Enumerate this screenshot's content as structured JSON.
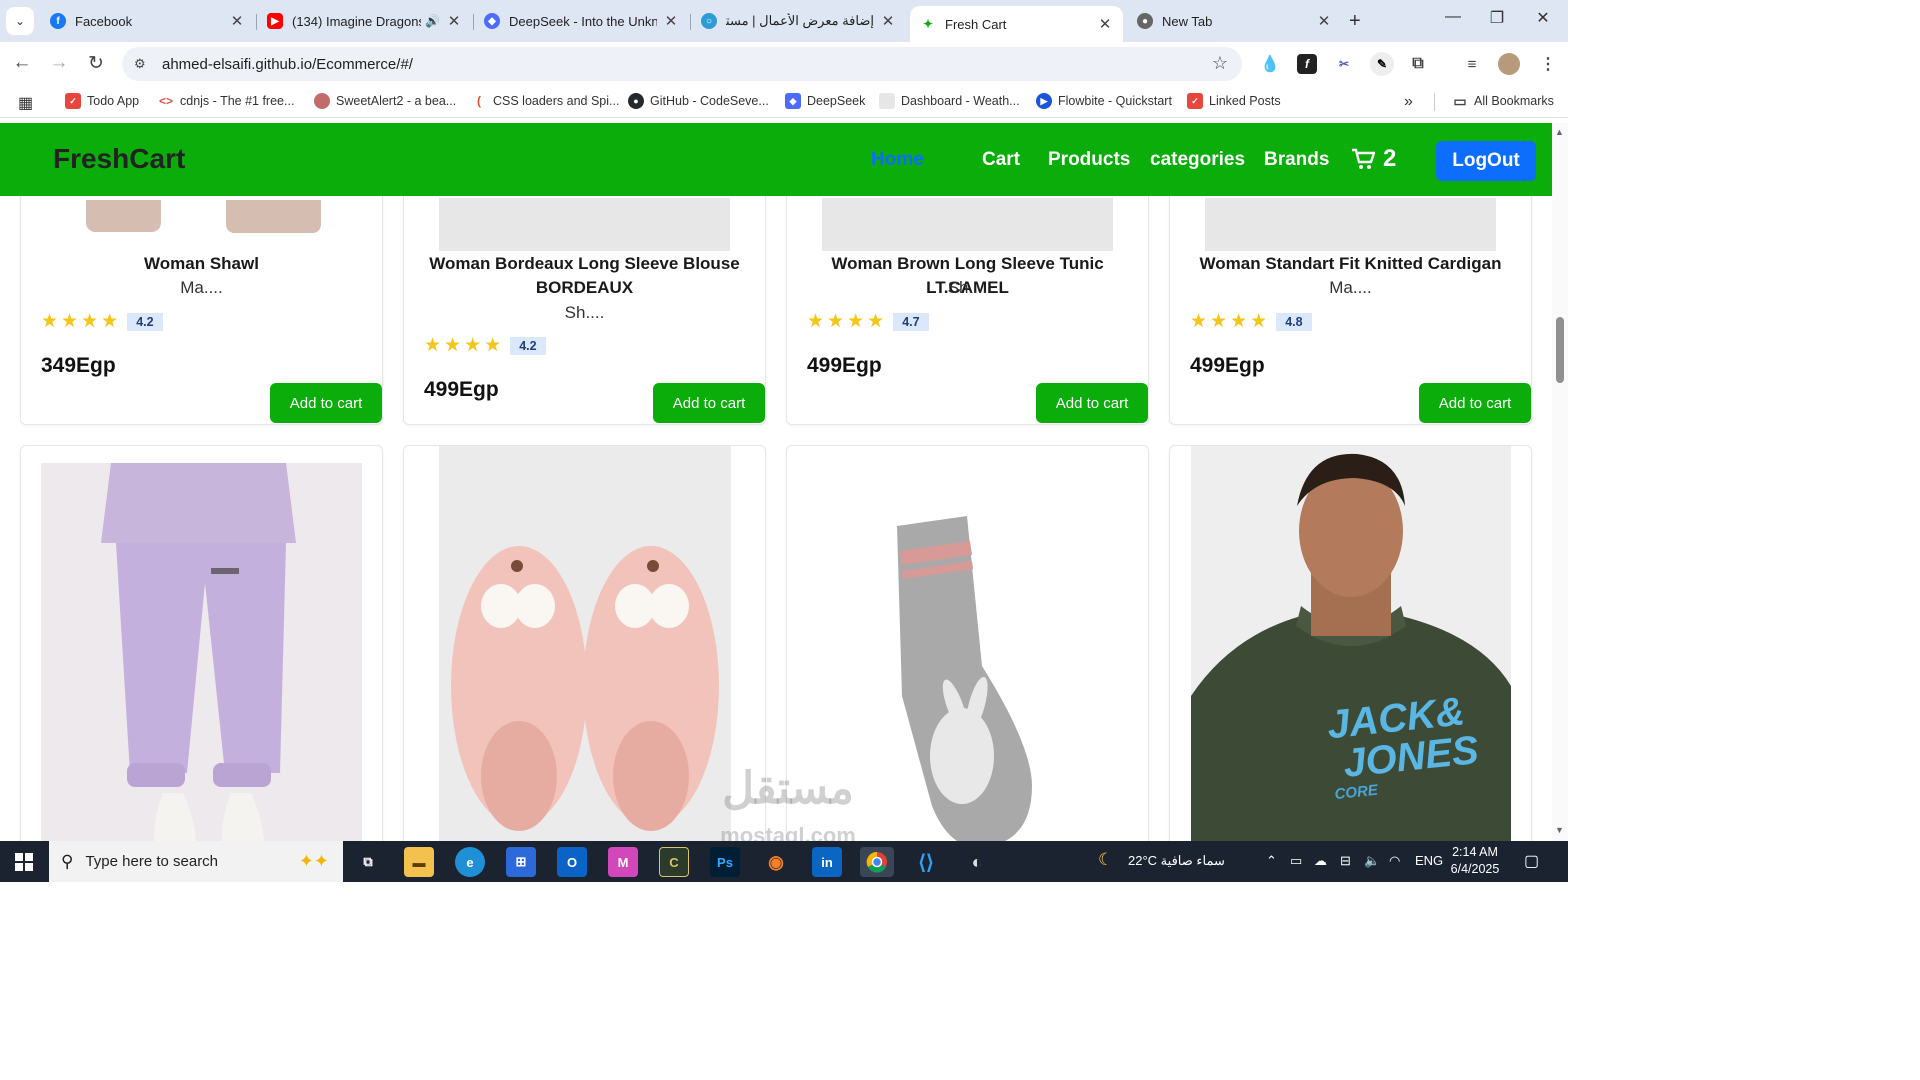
{
  "browser": {
    "tabs": [
      {
        "title": "Facebook",
        "icon": "facebook-icon",
        "color": "#1877f2"
      },
      {
        "title": "(134) Imagine Dragons",
        "icon": "youtube-icon",
        "color": "#ff0000"
      },
      {
        "title": "DeepSeek - Into the Unkno",
        "icon": "deepseek-icon",
        "color": "#4d6bfe"
      },
      {
        "title": "إضافة معرض الأعمال | مستقل",
        "icon": "mostaql-icon",
        "color": "#2c9bd6"
      },
      {
        "title": "Fresh Cart",
        "icon": "freshcart-icon",
        "color": "#0aad0a"
      },
      {
        "title": "New Tab",
        "icon": "chrome-icon",
        "color": "#666666"
      }
    ],
    "active_tab_index": 4,
    "url": "ahmed-elsaifi.github.io/Ecommerce/#/",
    "bookmarks": [
      {
        "label": "Todo App",
        "color": "#e8453c"
      },
      {
        "label": "cdnjs - The #1 free...",
        "color": "#d9534f"
      },
      {
        "label": "SweetAlert2 - a bea...",
        "color": "#c36b6b"
      },
      {
        "label": "CSS loaders and Spi...",
        "color": "#e34c26"
      },
      {
        "label": "GitHub - CodeSeve...",
        "color": "#24292e"
      },
      {
        "label": "DeepSeek",
        "color": "#4d6bfe"
      },
      {
        "label": "Dashboard - Weath...",
        "color": "#9aa0a6"
      },
      {
        "label": "Flowbite - Quickstart",
        "color": "#1a56db"
      },
      {
        "label": "Linked Posts",
        "color": "#e8453c"
      }
    ],
    "all_bookmarks": "All Bookmarks"
  },
  "site": {
    "brand": "FreshCart",
    "nav": [
      "Home",
      "Cart",
      "Products",
      "categories",
      "Brands"
    ],
    "active_nav": "Home",
    "cart_count": "2",
    "logout": "LogOut",
    "accent": "#0aad0a",
    "primary": "#0d6efd"
  },
  "products_row1": [
    {
      "title": "Woman Shawl",
      "category": "Ma....",
      "rating": "4.2",
      "price": "349Egp",
      "button": "Add to cart"
    },
    {
      "title": "Woman Bordeaux Long Sleeve Blouse BORDEAUX",
      "category": "Sh....",
      "rating": "4.2",
      "price": "499Egp",
      "button": "Add to cart"
    },
    {
      "title": "Woman Brown Long Sleeve Tunic LT.CAMEL",
      "category": "Sh....",
      "rating": "4.7",
      "price": "499Egp",
      "button": "Add to cart"
    },
    {
      "title": "Woman Standart Fit Knitted Cardigan",
      "category": "Ma....",
      "rating": "4.8",
      "price": "499Egp",
      "button": "Add to cart"
    }
  ],
  "products_row2": [
    {
      "image": "lilac-sweatpants"
    },
    {
      "image": "pink-fuzzy-slippers"
    },
    {
      "image": "grey-bugs-bunny-socks"
    },
    {
      "image": "jack-jones-tshirt",
      "shirt_text_1": "JACK&",
      "shirt_text_2": "JONES",
      "shirt_text_3": "CORE"
    }
  ],
  "taskbar": {
    "search_placeholder": "Type here to search",
    "weather": "22°C  سماء صافية",
    "language": "ENG",
    "time": "2:14 AM",
    "date": "6/4/2025"
  },
  "watermark": {
    "arabic": "مستقل",
    "latin": "mostaql.com"
  }
}
